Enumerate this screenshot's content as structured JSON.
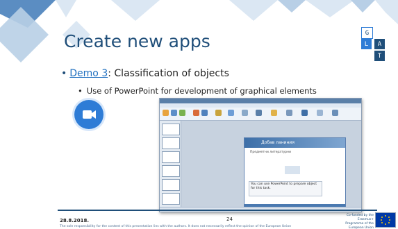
{
  "slide": {
    "title": "Create new apps",
    "bullet1": {
      "link_text": "Demo 3",
      "text": ": Classification of objects"
    },
    "bullet2": "Use of PowerPoint for development of graphical elements",
    "date": "28.8.2018.",
    "page_number": "24",
    "cofunded": "Co-funded by the Erasmus+ Programme of the European Union",
    "disclaimer": "The sole responsibility for the content of this presentation lies with the authors. It does not necessarily reflect the opinion of the European Union"
  },
  "logo": {
    "letters": [
      "G",
      "L",
      "A",
      "T"
    ]
  },
  "screenshot": {
    "dialog_title": "Добав ланиния",
    "dialog_subtitle": "Предметни литературни",
    "dialog_note": "You can use PowerPoint to prepare object for this task."
  },
  "colors": {
    "title": "#1f4e79",
    "link": "#1f6fbf",
    "video_button": "#2e7cd6",
    "deco_light": "#dbe7f3",
    "deco_mid": "#b8cfe6",
    "deco_dark": "#5b8dc2"
  },
  "icons": {
    "video": "video-camera-icon",
    "eu_flag": "eu-flag-icon"
  }
}
